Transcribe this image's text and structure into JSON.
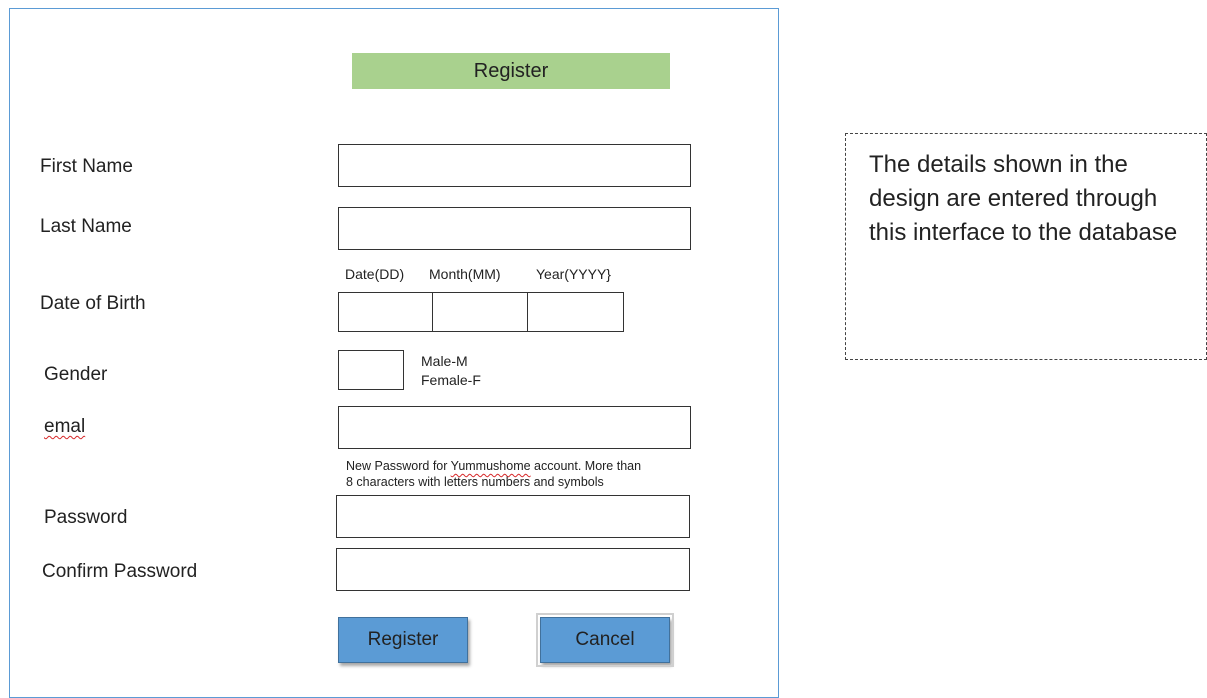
{
  "form": {
    "title": "Register",
    "first_name_label": "First Name",
    "last_name_label": "Last Name",
    "dob": {
      "label": "Date of Birth",
      "day_header": "Date(DD)",
      "month_header": "Month(MM)",
      "year_header": "Year(YYYY}"
    },
    "gender": {
      "label": "Gender",
      "hint_line1": "Male-M",
      "hint_line2": "Female-F"
    },
    "email_label": "emal",
    "password_hint": {
      "part1": "New Password for ",
      "brand": "Yummushome",
      "part2": " account. More than",
      "line2": "8 characters with letters numbers and symbols"
    },
    "password_label": "Password",
    "confirm_password_label": "Confirm Password",
    "buttons": {
      "register": "Register",
      "cancel": "Cancel"
    }
  },
  "note": {
    "text": "The details shown in the design are entered through this interface to the database"
  },
  "colors": {
    "title_bar": "#a9d18e",
    "frame_border": "#5b9bd5",
    "button_fill": "#5b9bd5"
  }
}
